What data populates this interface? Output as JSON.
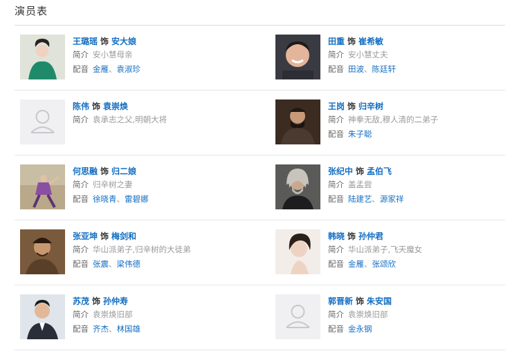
{
  "section_title": "演员表",
  "labels": {
    "as": "饰",
    "intro": "简介",
    "voice": "配音",
    "sep": "、"
  },
  "cast": [
    {
      "actor": "王璐瑶",
      "role": "安大娘",
      "intro": "安小慧母亲",
      "voice": [
        "金雁",
        "袁淑珍"
      ],
      "photo": "woman-green-dress"
    },
    {
      "actor": "田重",
      "role": "崔希敏",
      "intro": "安小慧丈夫",
      "voice": [
        "田波",
        "陈廷轩"
      ],
      "photo": "man-smiling"
    },
    {
      "actor": "陈伟",
      "role": "袁崇焕",
      "intro": "袁承志之父,明朝大将",
      "voice": [],
      "photo": "placeholder"
    },
    {
      "actor": "王岗",
      "role": "归辛树",
      "intro": "神拳无敌,穆人清的二弟子",
      "voice": [
        "朱子聪"
      ],
      "photo": "man-costume-dark"
    },
    {
      "actor": "何思融",
      "role": "归二娘",
      "intro": "归辛树之妻",
      "voice": [
        "徐晓青",
        "雷碧娜"
      ],
      "photo": "woman-martial-arts"
    },
    {
      "actor": "张纪中",
      "role": "孟伯飞",
      "intro": "盖孟尝",
      "voice": [
        "陆建艺",
        "源家祥"
      ],
      "photo": "man-long-hair-beard"
    },
    {
      "actor": "张亚坤",
      "role": "梅剑和",
      "intro": "华山派弟子,归辛树的大徒弟",
      "voice": [
        "张震",
        "梁伟德"
      ],
      "photo": "man-costume-brown"
    },
    {
      "actor": "韩晓",
      "role": "孙仲君",
      "intro": "华山派弟子,飞天魔女",
      "voice": [
        "金雁",
        "张颂欣"
      ],
      "photo": "woman-portrait"
    },
    {
      "actor": "苏茂",
      "role": "孙仲寿",
      "intro": "袁崇焕旧部",
      "voice": [
        "齐杰",
        "林国雄"
      ],
      "photo": "man-suit"
    },
    {
      "actor": "郭晋新",
      "role": "朱安国",
      "intro": "袁崇焕旧部",
      "voice": [
        "金永钢"
      ],
      "photo": "placeholder"
    }
  ]
}
